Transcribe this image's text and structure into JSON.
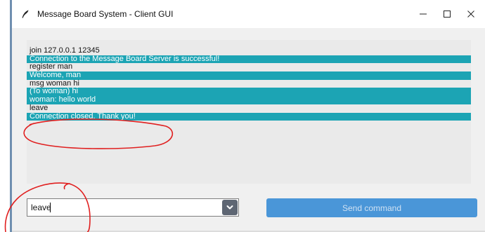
{
  "window": {
    "title": "Message Board System - Client GUI",
    "icon": "feather-icon",
    "controls": {
      "minimize_icon": "minimize-icon",
      "maximize_icon": "maximize-icon",
      "close_icon": "close-icon"
    }
  },
  "log": {
    "lines": [
      {
        "text": "join 127.0.0.1 12345",
        "highlighted": false
      },
      {
        "text": "Connection to the Message Board Server is successful!",
        "highlighted": true
      },
      {
        "text": "register man",
        "highlighted": false
      },
      {
        "text": "Welcome, man",
        "highlighted": true
      },
      {
        "text": "msg woman hi",
        "highlighted": false
      },
      {
        "text": "(To woman) hi",
        "highlighted": true
      },
      {
        "text": "woman: hello world",
        "highlighted": true
      },
      {
        "text": "leave",
        "highlighted": false
      },
      {
        "text": "Connection closed. Thank you!",
        "highlighted": true
      }
    ]
  },
  "command": {
    "value": "leave",
    "dropdown_icon": "chevron-down-icon"
  },
  "send_button": {
    "label": "Send command"
  },
  "colors": {
    "highlight": "#1ca4b4",
    "send_button": "#4a96d8",
    "annotation": "#e02020"
  }
}
